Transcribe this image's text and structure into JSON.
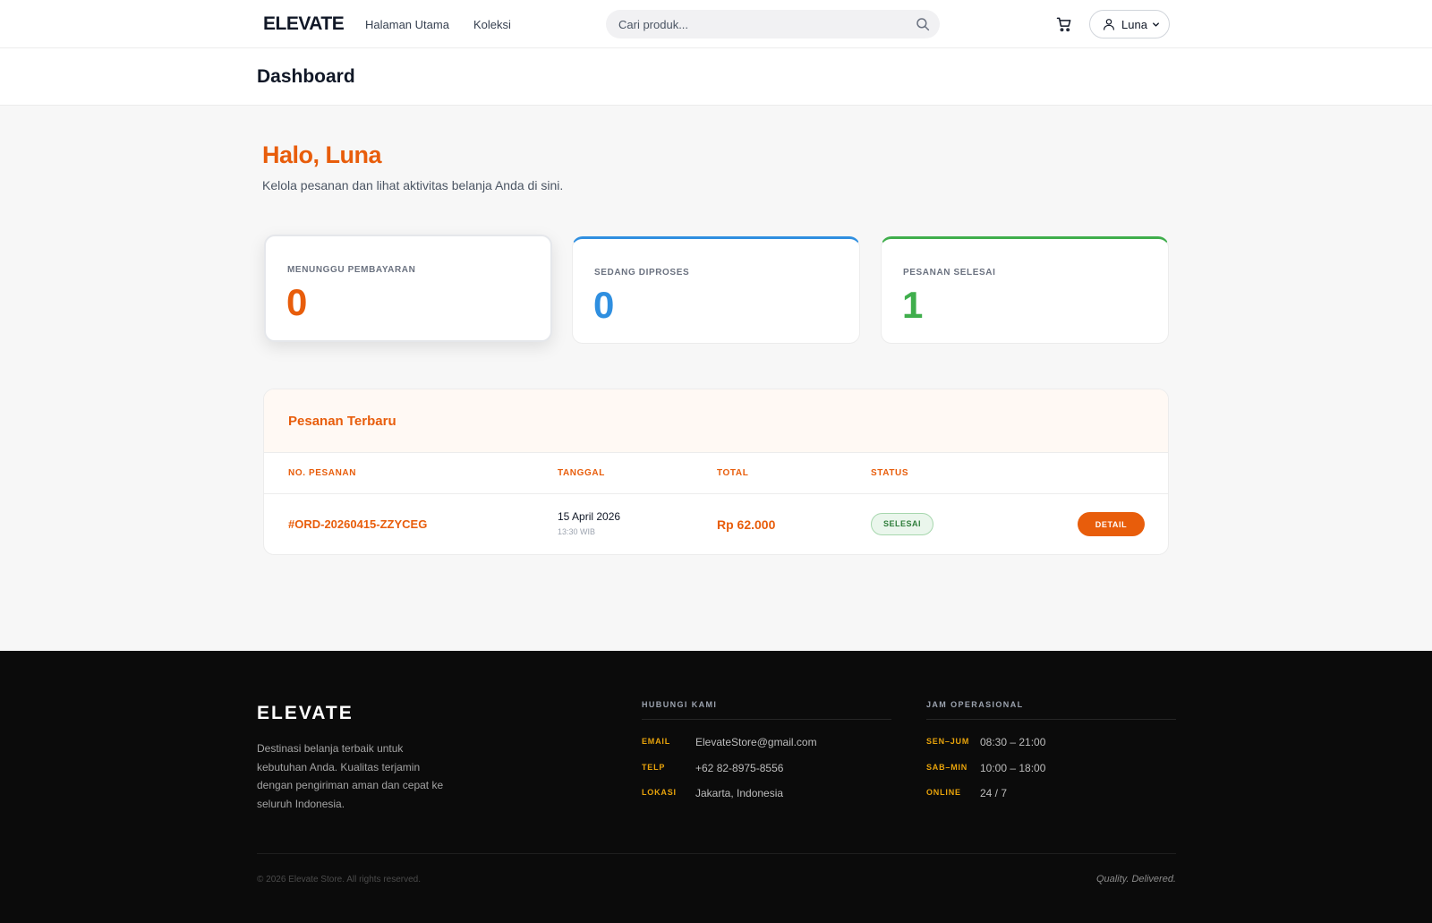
{
  "header": {
    "brand": "ELEVATE",
    "nav": [
      "Halaman Utama",
      "Koleksi"
    ],
    "search_placeholder": "Cari produk...",
    "user_name": "Luna"
  },
  "page_title": "Dashboard",
  "greeting": {
    "title": "Halo, Luna",
    "subtitle": "Kelola pesanan dan lihat aktivitas belanja Anda di sini."
  },
  "stats": [
    {
      "label": "MENUNGGU PEMBAYARAN",
      "value": "0",
      "color": "#e85d0b"
    },
    {
      "label": "SEDANG DIPROSES",
      "value": "0",
      "color": "#2f8fe0"
    },
    {
      "label": "PESANAN SELESAI",
      "value": "1",
      "color": "#3fae4c"
    }
  ],
  "orders": {
    "title": "Pesanan Terbaru",
    "columns": [
      "NO. PESANAN",
      "TANGGAL",
      "TOTAL",
      "STATUS"
    ],
    "rows": [
      {
        "order_no": "#ORD-20260415-ZZYCEG",
        "date": "15 April 2026",
        "time": "13:30 WIB",
        "total": "Rp 62.000",
        "status": "SELESAI",
        "action": "DETAIL"
      }
    ]
  },
  "footer": {
    "brand": "ELEVATE",
    "description": "Destinasi belanja terbaik untuk kebutuhan Anda. Kualitas terjamin dengan pengiriman aman dan cepat ke seluruh Indonesia.",
    "contact": {
      "title": "HUBUNGI KAMI",
      "items": [
        {
          "key": "EMAIL",
          "value": "ElevateStore@gmail.com"
        },
        {
          "key": "TELP",
          "value": "+62 82-8975-8556"
        },
        {
          "key": "LOKASI",
          "value": "Jakarta, Indonesia"
        }
      ]
    },
    "hours": {
      "title": "JAM OPERASIONAL",
      "items": [
        {
          "key": "SEN–JUM",
          "value": "08:30 – 21:00"
        },
        {
          "key": "SAB–MIN",
          "value": "10:00 – 18:00"
        },
        {
          "key": "ONLINE",
          "value": "24 / 7"
        }
      ]
    },
    "copyright": "© 2026 Elevate Store. All rights reserved.",
    "tagline": "Quality. Delivered."
  },
  "colors": {
    "accent": "#e85d0b",
    "blue": "#2f8fe0",
    "green": "#3fae4c",
    "footer_bg": "#0b0b0b",
    "footer_key": "#e8a30b"
  },
  "icons": [
    "search-icon",
    "cart-icon",
    "user-icon",
    "chevron-down-icon"
  ]
}
